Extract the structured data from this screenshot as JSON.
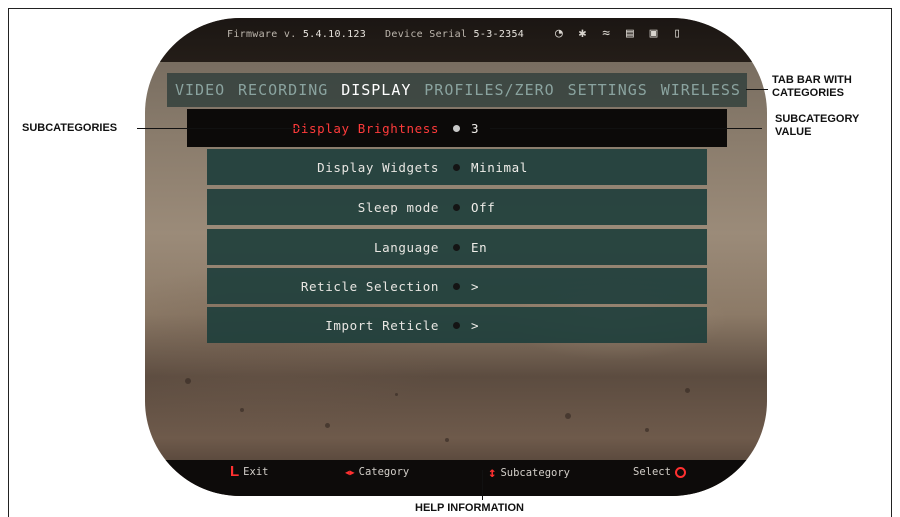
{
  "status": {
    "firmware_label": "Firmware v.",
    "firmware_version": "5.4.10.123",
    "serial_label": "Device Serial",
    "serial_value": "5-3-2354",
    "icons": "◔ ✱ ≈ ▤ ▣ ▯"
  },
  "tabs": [
    {
      "label": "VIDEO",
      "active": false
    },
    {
      "label": "RECORDING",
      "active": false
    },
    {
      "label": "DISPLAY",
      "active": true
    },
    {
      "label": "PROFILES/ZERO",
      "active": false
    },
    {
      "label": "SETTINGS",
      "active": false
    },
    {
      "label": "WIRELESS",
      "active": false
    }
  ],
  "menu": [
    {
      "label": "Display Brightness",
      "value": "3",
      "selected": true
    },
    {
      "label": "Display Widgets",
      "value": "Minimal",
      "selected": false
    },
    {
      "label": "Sleep mode",
      "value": "Off",
      "selected": false
    },
    {
      "label": "Language",
      "value": "En",
      "selected": false
    },
    {
      "label": "Reticle Selection",
      "value": ">",
      "selected": false
    },
    {
      "label": "Import Reticle",
      "value": ">",
      "selected": false
    }
  ],
  "help": {
    "exit_key": "L",
    "exit_label": "Exit",
    "category_icon": "◀▶",
    "category_label": "Category",
    "subcategory_icon": "↕",
    "subcategory_label": "Subcategory",
    "select_label": "Select"
  },
  "callouts": {
    "tab_bar_line1": "TAB BAR WITH",
    "tab_bar_line2": "CATEGORIES",
    "subcategories": "SUBCATEGORIES",
    "subcategory_value_line1": "SUBCATEGORY",
    "subcategory_value_line2": "VALUE",
    "help_information": "HELP INFORMATION"
  },
  "colors": {
    "accent_red": "#ff3030",
    "row_bg": "#1f3f3c",
    "tab_bg": "#2d3c3a"
  }
}
